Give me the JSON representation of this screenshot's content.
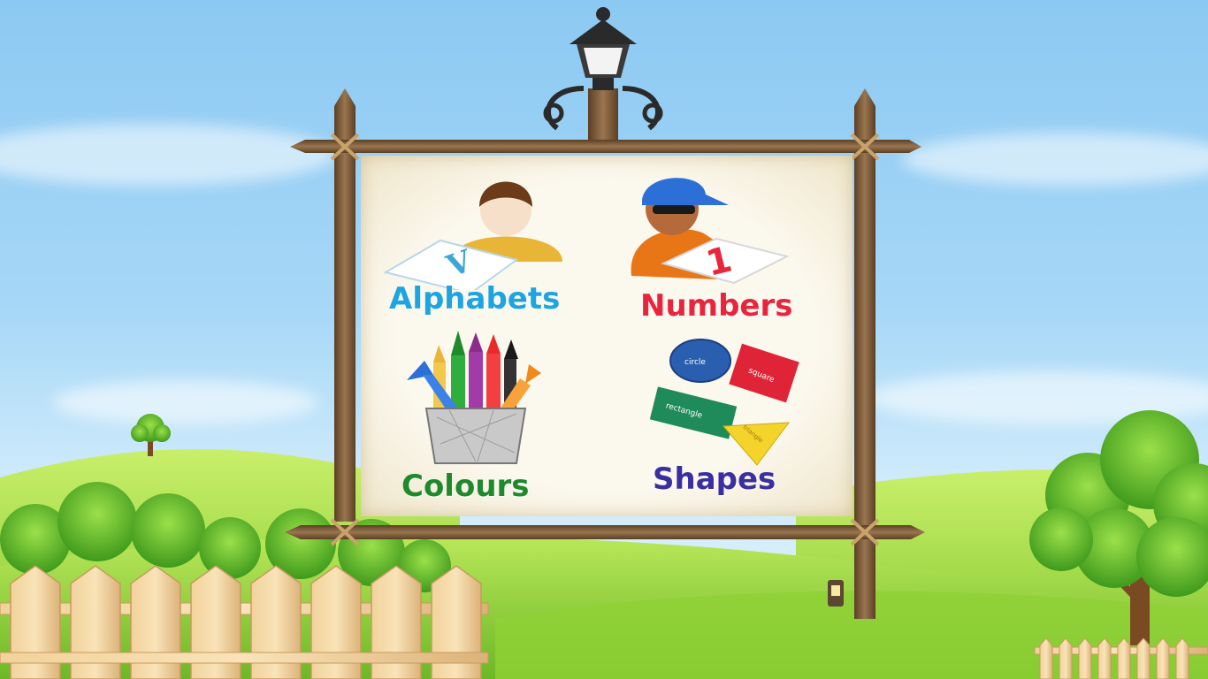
{
  "menu": {
    "items": [
      {
        "label": "Alphabets",
        "color": "#1ea4e0"
      },
      {
        "label": "Numbers",
        "color": "#e8253c"
      },
      {
        "label": "Colours",
        "color": "#1e8a2c"
      },
      {
        "label": "Shapes",
        "color": "#3a2fa0"
      }
    ],
    "alphabet_card_letter": "V",
    "number_card_digit": "1",
    "shape_words": {
      "circle": "circle",
      "square": "square",
      "rectangle": "rectangle",
      "triangle": "triangle"
    }
  },
  "palette": {
    "sky": "#8cc9f2",
    "grass": "#8fd136",
    "wood": "#7a5a3a",
    "board": "#fbf8ee"
  }
}
